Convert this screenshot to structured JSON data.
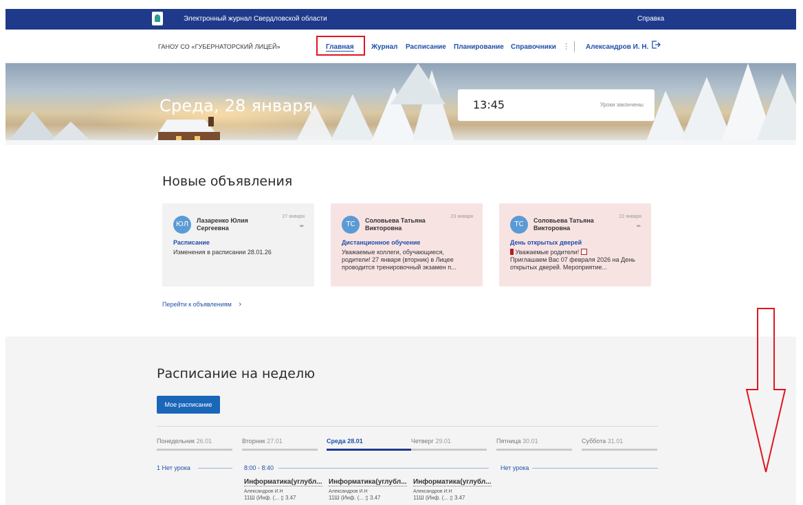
{
  "topbar": {
    "title": "Электронный журнал Свердловской области",
    "help": "Справка"
  },
  "nav": {
    "org": "ГАНОУ СО «ГУБЕРНАТОРСКИЙ ЛИЦЕЙ»",
    "items": [
      "Главная",
      "Журнал",
      "Расписание",
      "Планирование",
      "Справочники"
    ],
    "active": "Главная",
    "more": "⋮",
    "user": "Александров И. Н."
  },
  "hero": {
    "date": "Среда, 28 января",
    "time": "13:45",
    "status": "Уроки закончены"
  },
  "announcements": {
    "title": "Новые объявления",
    "items": [
      {
        "initials": "ЮЛ",
        "author": "Лазаренко Юлия Сергеевна",
        "date": "27 января",
        "subject": "Расписание",
        "body": "Изменения в расписании 28.01.26"
      },
      {
        "initials": "ТС",
        "author": "Соловьева Татьяна Викторовна",
        "date": "23 января",
        "subject": "Дистанционное обучение",
        "body": "Уважаемые коллеги, обучающиеся, родители! 27 января (вторник) в Лицее проводится тренировочный экзамен п..."
      },
      {
        "initials": "ТС",
        "author": "Соловьева Татьяна Викторовна",
        "date": "22 января",
        "subject": "День открытых дверей",
        "body_line1": "Уважаемые родители!",
        "body_rest": "Приглашаем Вас 07 февраля 2026 на День открытых дверей. Мероприятие..."
      }
    ],
    "more_link": "Перейти к объявлениям"
  },
  "schedule": {
    "title": "Расписание на неделю",
    "my_button": "Мое расписание",
    "days": [
      {
        "name": "Понедельник",
        "date": "26.01"
      },
      {
        "name": "Вторник",
        "date": "27.01"
      },
      {
        "name": "Среда",
        "date": "28.01"
      },
      {
        "name": "Четверг",
        "date": "29.01"
      },
      {
        "name": "Пятница",
        "date": "30.01"
      },
      {
        "name": "Суббота",
        "date": "31.01"
      }
    ],
    "active_day": "Среда",
    "monday_row": "1 Нет урока",
    "time_slot": "8:00 - 8:40",
    "friday_row": "Нет урока",
    "lessons": [
      {
        "name": "Информатика(углубл...",
        "teacher": "Александров И.Н",
        "room": "11Ш (Инф. (...",
        "room_no": "3.47"
      },
      {
        "name": "Информатика(углубл...",
        "teacher": "Александров И.Н",
        "room": "11Ш (Инф. (...",
        "room_no": "3.47"
      },
      {
        "name": "Информатика(углубл...",
        "teacher": "Александров И.Н",
        "room": "11Ш (Инф. (...",
        "room_no": "3.47"
      }
    ]
  },
  "colors": {
    "brand": "#1f3a8a",
    "link": "#1f4fa8",
    "highlight": "#e0141e",
    "button": "#1a66b8"
  }
}
